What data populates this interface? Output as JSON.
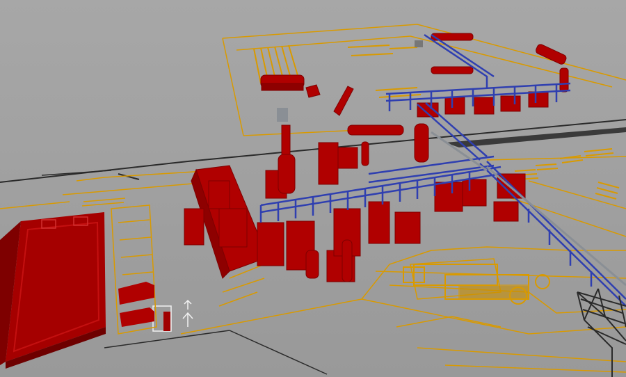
{
  "colors": {
    "ground_far": "#a5a5a5",
    "ground_near": "#9b9b9b",
    "plan_line": "#d99a00",
    "equipment": "#b00000",
    "equipment_dark": "#7e0000",
    "equipment_light": "#cf1a1a",
    "pipe_rack": "#2f3fb0",
    "pipe_gray": "#8a8f95",
    "road_line": "#2a2a2a",
    "marking": "#f2f2f2"
  },
  "icons": [
    "arrow-up-icon"
  ]
}
